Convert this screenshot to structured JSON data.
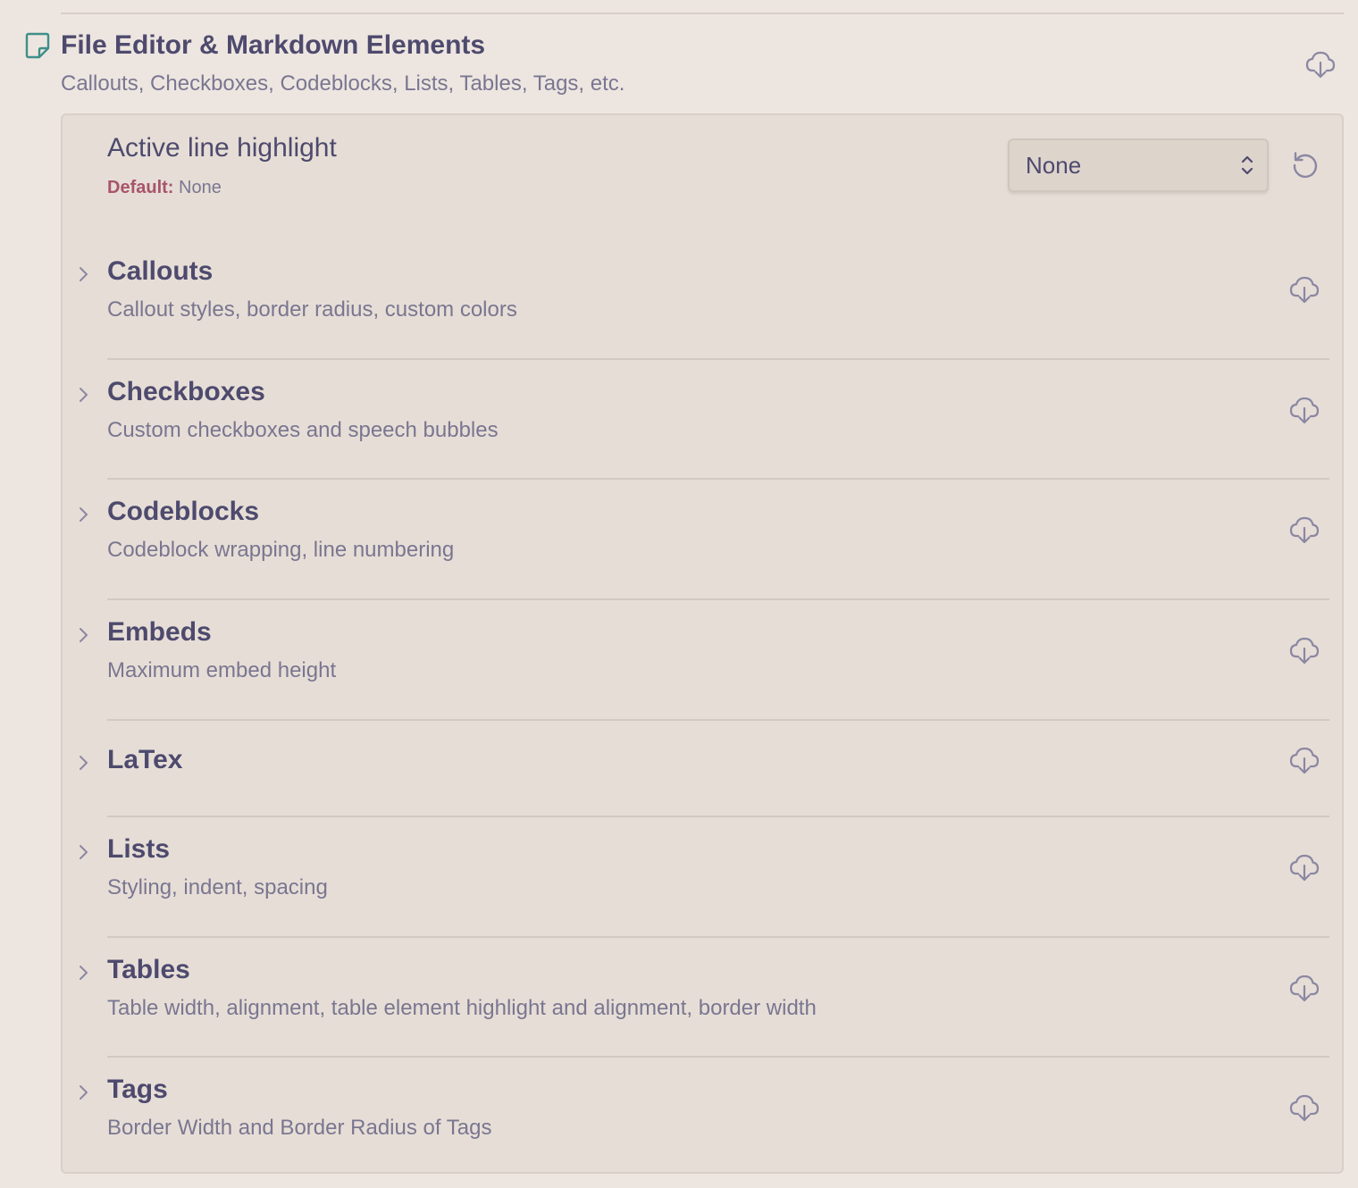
{
  "section": {
    "title": "File Editor & Markdown Elements",
    "description": "Callouts, Checkboxes, Codeblocks, Lists, Tables, Tags, etc.",
    "icon": "sticky-note-icon",
    "download_icon": "cloud-download-icon"
  },
  "active_line": {
    "label": "Active line highlight",
    "default_label": "Default:",
    "default_value": "None",
    "selected": "None",
    "reset_icon": "reset-icon"
  },
  "items": [
    {
      "title": "Callouts",
      "description": "Callout styles, border radius, custom colors"
    },
    {
      "title": "Checkboxes",
      "description": "Custom checkboxes and speech bubbles"
    },
    {
      "title": "Codeblocks",
      "description": "Codeblock wrapping, line numbering"
    },
    {
      "title": "Embeds",
      "description": "Maximum embed height"
    },
    {
      "title": "LaTex",
      "description": ""
    },
    {
      "title": "Lists",
      "description": "Styling, indent, spacing"
    },
    {
      "title": "Tables",
      "description": "Table width, alignment, table element highlight and alignment, border width"
    },
    {
      "title": "Tags",
      "description": "Border Width and Border Radius of Tags"
    }
  ],
  "colors": {
    "background": "#ede6e0",
    "panel": "#e6ded6",
    "text": "#4e4a6e",
    "muted": "#7a7691",
    "default_accent": "#a8546c",
    "note_icon": "#3e8f8a"
  }
}
